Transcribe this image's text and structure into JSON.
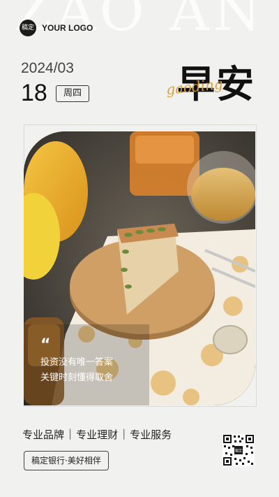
{
  "watermark": "ZAO AN",
  "logo": {
    "badge": "稿定",
    "text": "YOUR LOGO"
  },
  "date": {
    "year_month": "2024/03",
    "day": "18",
    "weekday": "周四"
  },
  "title": {
    "main": "早安",
    "script": "gaoding"
  },
  "quote": {
    "mark": "“",
    "line1": "投资没有唯一答案",
    "line2": "关键时刻懂得取舍"
  },
  "tags": [
    "专业品牌",
    "专业理财",
    "专业服务"
  ],
  "slogan": "稿定银行·美好相伴",
  "qr": {
    "center_label": "稿定"
  },
  "colors": {
    "accent": "#d8a23c",
    "background": "#f1f1ef",
    "dark": "#1b1b1b"
  }
}
